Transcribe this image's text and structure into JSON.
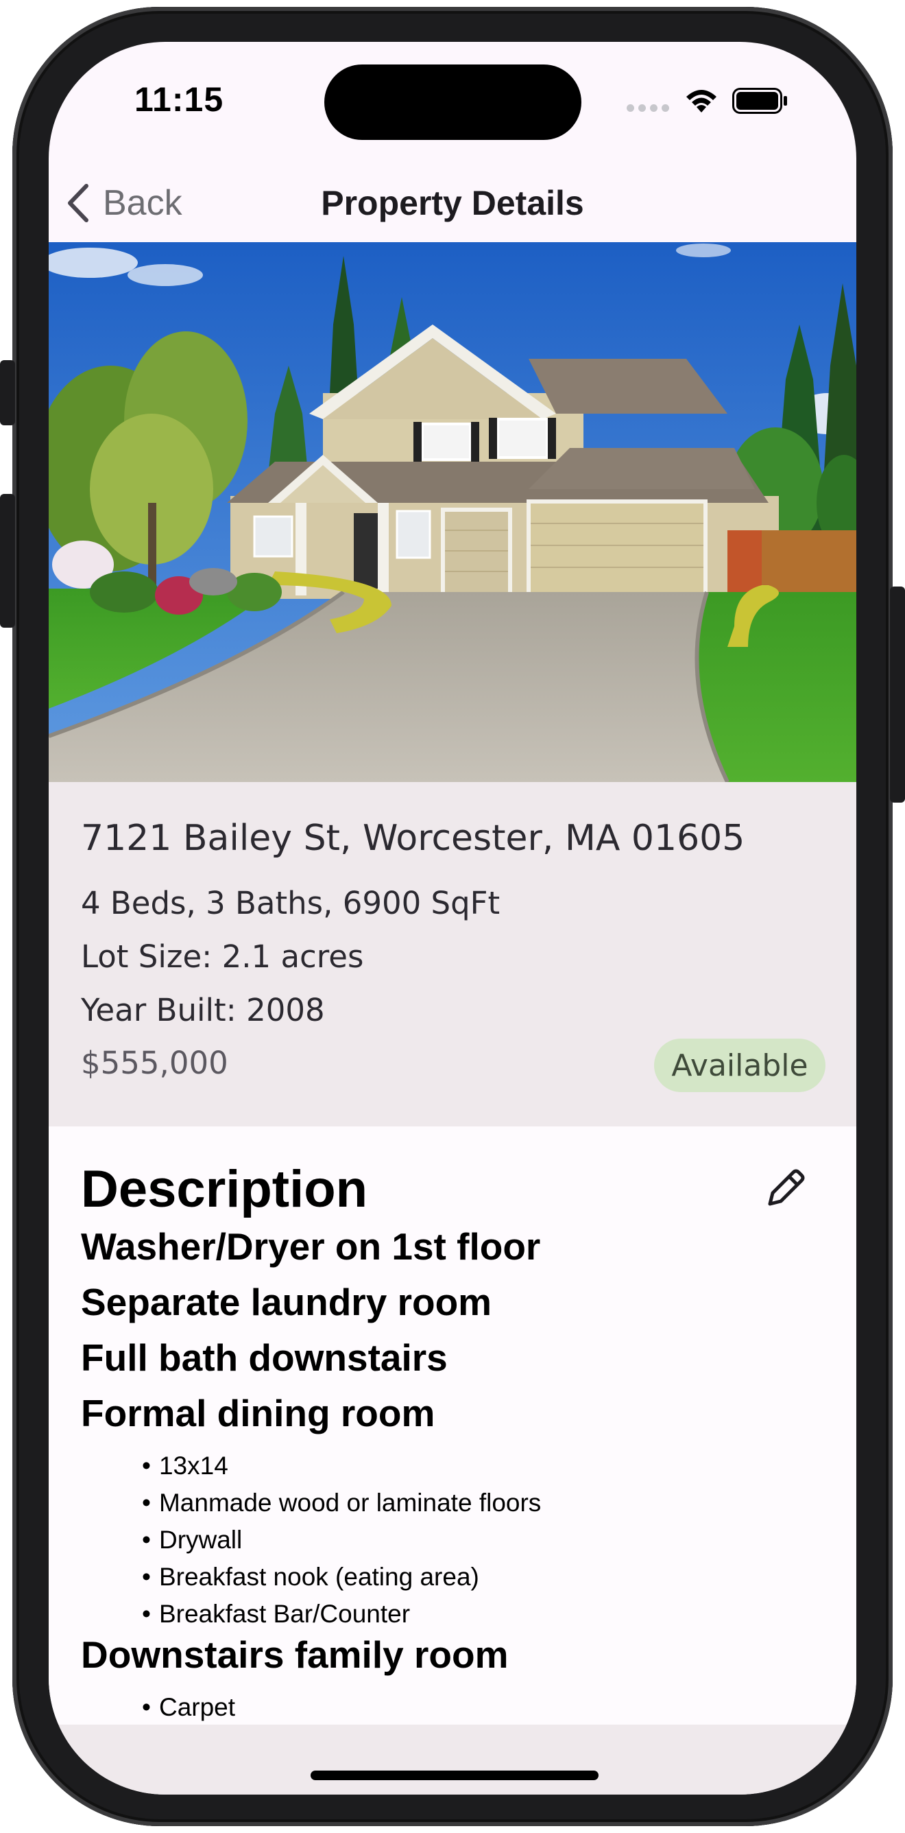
{
  "status_bar": {
    "time": "11:15",
    "signal_icon": "cellular-dots-icon",
    "wifi_icon": "wifi-icon",
    "battery_icon": "battery-full-icon"
  },
  "nav": {
    "back_label": "Back",
    "title": "Property Details"
  },
  "property": {
    "address": "7121 Bailey St, Worcester, MA 01605",
    "summary": "4 Beds, 3 Baths, 6900 SqFt",
    "lot_size": "Lot Size: 2.1 acres",
    "year_built": "Year Built: 2008",
    "price": "$555,000",
    "status": "Available"
  },
  "description": {
    "title": "Description",
    "edit_icon": "pencil-icon",
    "features": [
      "Washer/Dryer on 1st floor",
      "Separate laundry room",
      "Full bath downstairs",
      "Formal dining room"
    ],
    "dining_details": [
      "13x14",
      "Manmade wood or laminate floors",
      "Drywall",
      "Breakfast nook (eating area)",
      "Breakfast Bar/Counter"
    ],
    "family_room": "Downstairs family room",
    "family_room_details": [
      "Carpet"
    ]
  },
  "colors": {
    "screen_background": "#fdf7fd",
    "info_card": "#efe9ec",
    "badge_background": "#d4e6c7",
    "badge_text": "#3f4a3a"
  }
}
